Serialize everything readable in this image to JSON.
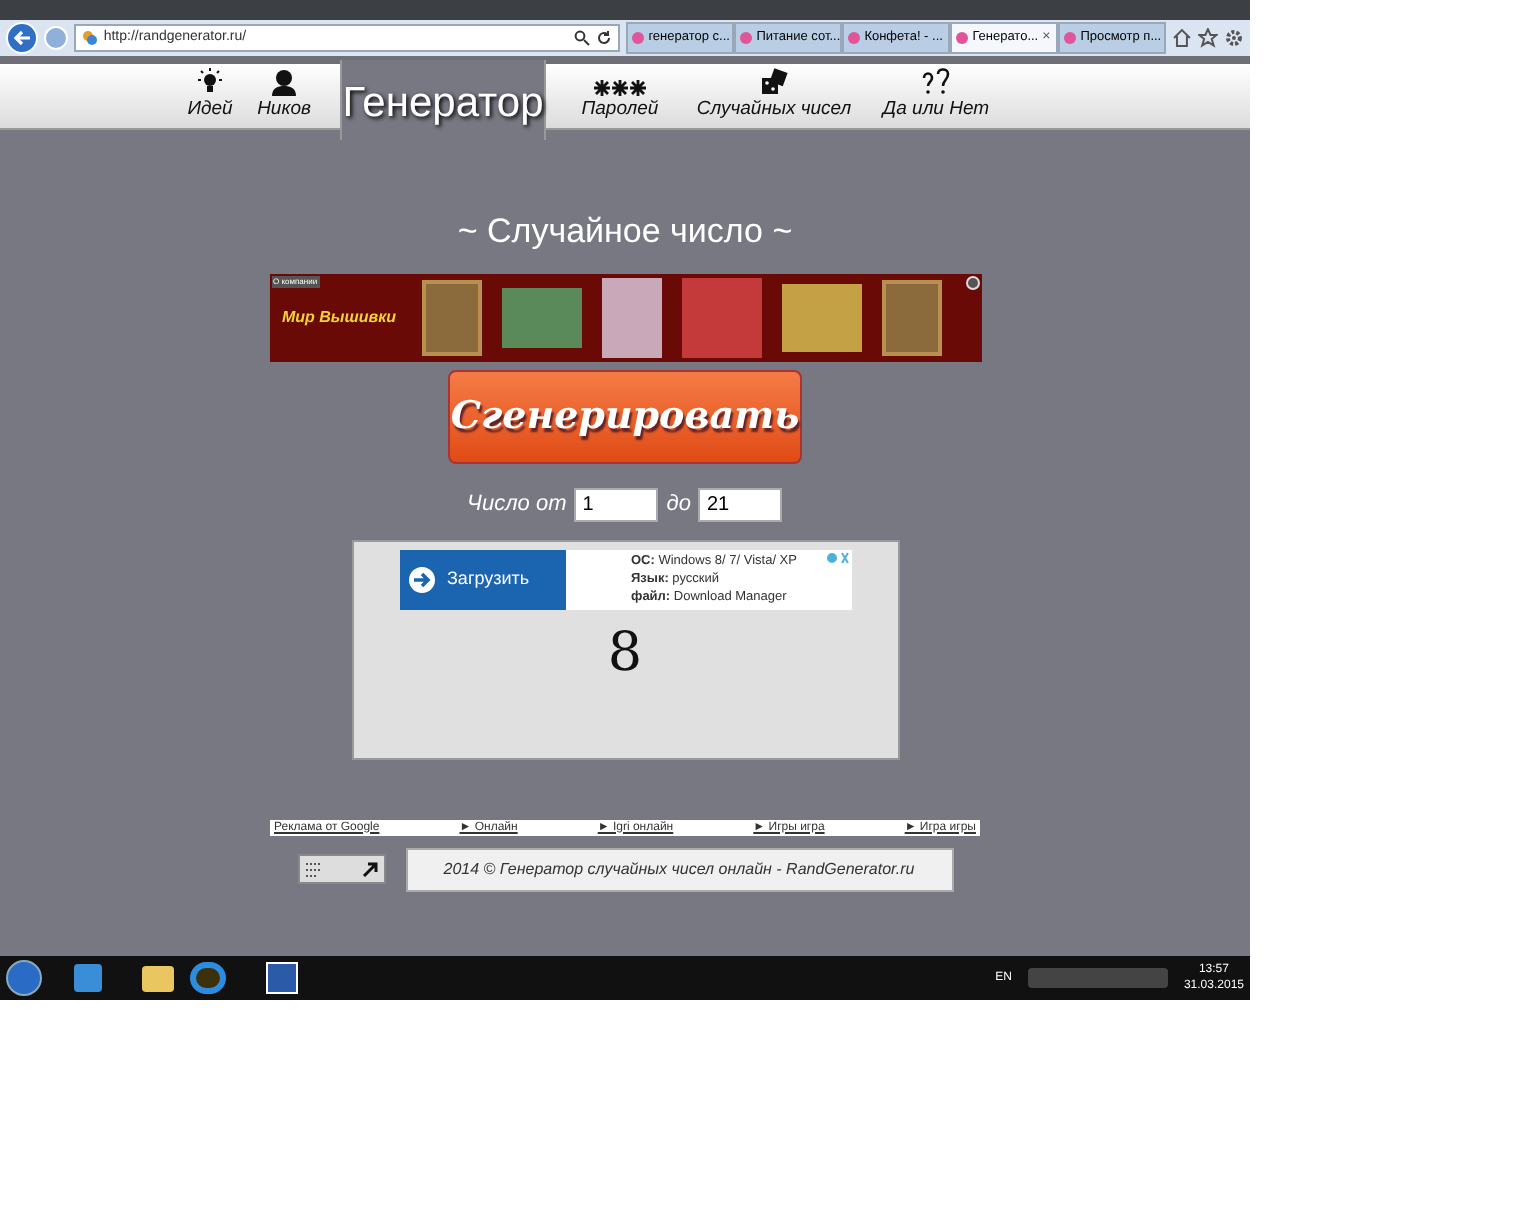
{
  "browser": {
    "address": "http://randgenerator.ru/",
    "tabs": [
      {
        "label": "генератор с...",
        "selected": false
      },
      {
        "label": "Питание сот...",
        "selected": false
      },
      {
        "label": "Конфета! - ...",
        "selected": false
      },
      {
        "label": "Генерато...",
        "selected": true
      },
      {
        "label": "Просмотр п...",
        "selected": false
      }
    ],
    "close_tab": "×"
  },
  "nav": [
    {
      "label": "Идей",
      "selected": false
    },
    {
      "label": "Ников",
      "selected": false
    },
    {
      "label": "Генератор",
      "selected": true
    },
    {
      "label": "Паролей",
      "selected": false
    },
    {
      "label": "Случайных чисел",
      "selected": false
    },
    {
      "label": "Да или Нет",
      "selected": false
    }
  ],
  "heading": "~ Случайное число ~",
  "banner": {
    "corner_label": "О компании",
    "brand": "Мир Вышивки"
  },
  "generate_button": "Сгенерировать",
  "range": {
    "from_label": "Число от",
    "from_value": "1",
    "to_label": "до",
    "to_value": "21"
  },
  "result_panel": {
    "ad": {
      "button": "Загрузить",
      "lines": [
        "**ОС:** Windows 8/ 7/ Vista/ XP",
        "**Язык:** русский",
        "**файл:** Download Manager"
      ]
    },
    "result": "8"
  },
  "links": [
    "Реклама от Google",
    "► Онлайн",
    "► Igri онлайн",
    "► Игры игра",
    "► Игра игры"
  ],
  "footer": "2014 © Генератор случайных чисел онлайн - RandGenerator.ru",
  "taskbar": {
    "language": "EN",
    "time": "13:57",
    "date": "31.03.2015"
  }
}
